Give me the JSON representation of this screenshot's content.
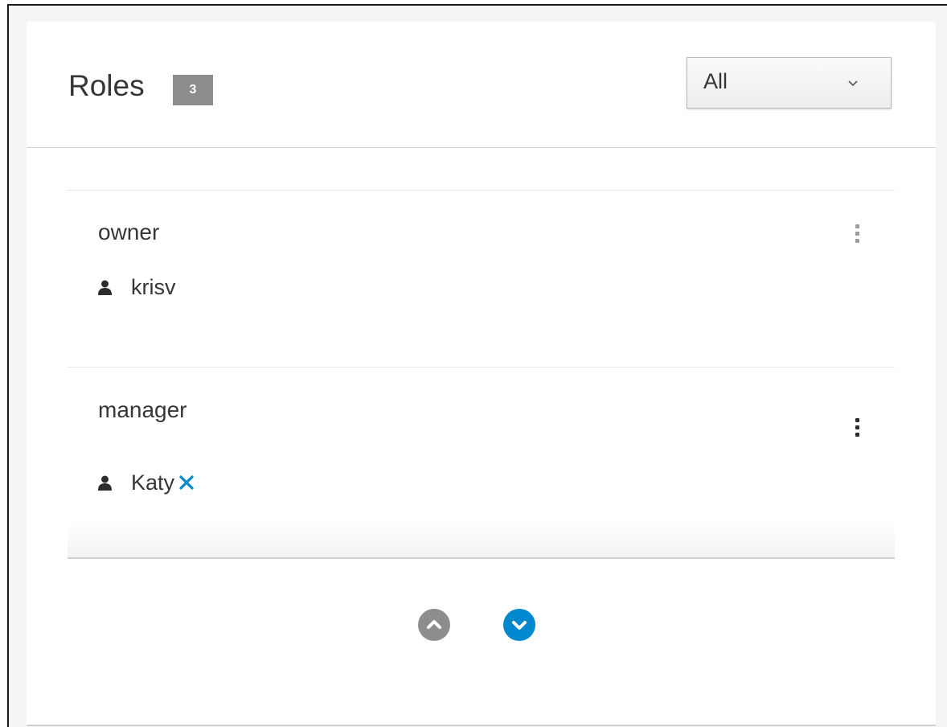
{
  "header": {
    "title": "Roles",
    "count": "3"
  },
  "filter": {
    "selected": "All",
    "icon": "chevron-down-icon"
  },
  "roles": [
    {
      "name": "owner",
      "users": [
        {
          "name": "krisv",
          "icon": "user-icon",
          "removable": false
        }
      ],
      "menu_icon": "kebab-icon"
    },
    {
      "name": "manager",
      "users": [
        {
          "name": "Katy",
          "icon": "user-icon",
          "removable": true,
          "remove_icon": "close-icon"
        }
      ],
      "menu_icon": "kebab-icon"
    }
  ],
  "pager": {
    "previous_icon": "chevron-up-circle-icon",
    "next_icon": "chevron-down-circle-icon"
  },
  "colors": {
    "accent": "#0088ce",
    "muted": "#8b8d8f",
    "text": "#363636",
    "border": "#d1d1d1"
  }
}
